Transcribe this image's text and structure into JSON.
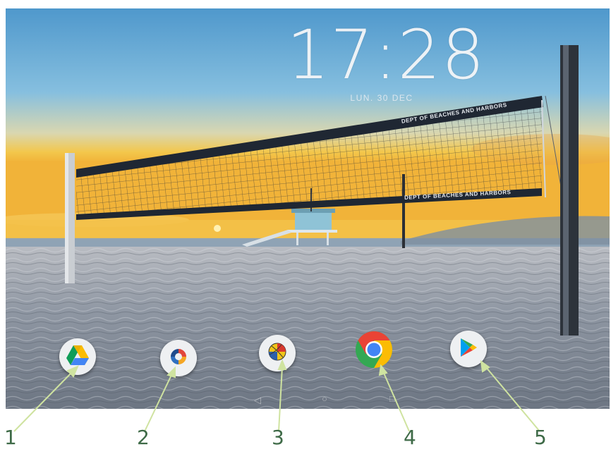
{
  "lock_screen": {
    "time": "17:28",
    "date": "LUN. 30 DEC"
  },
  "dock": {
    "apps": [
      {
        "name": "Google Drive",
        "icon": "google-drive-icon"
      },
      {
        "name": "App 2",
        "icon": "swirl-app-icon"
      },
      {
        "name": "App 3",
        "icon": "volleyball-app-icon"
      },
      {
        "name": "Chrome",
        "icon": "chrome-icon"
      },
      {
        "name": "Play Store",
        "icon": "play-store-icon"
      }
    ]
  },
  "navigation": {
    "back": "◁",
    "home": "○",
    "recents": "□"
  },
  "callouts": {
    "labels": [
      "1",
      "2",
      "3",
      "4",
      "5"
    ],
    "color": "#cfe3a0"
  },
  "wallpaper": {
    "net_band_text": "DEPT OF BEACHES AND HARBORS"
  },
  "colors": {
    "sky_top": "#5ea3cf",
    "sunset": "#f5c23c",
    "sand": "#9aa2ad",
    "callout_text": "#3e6a47"
  }
}
